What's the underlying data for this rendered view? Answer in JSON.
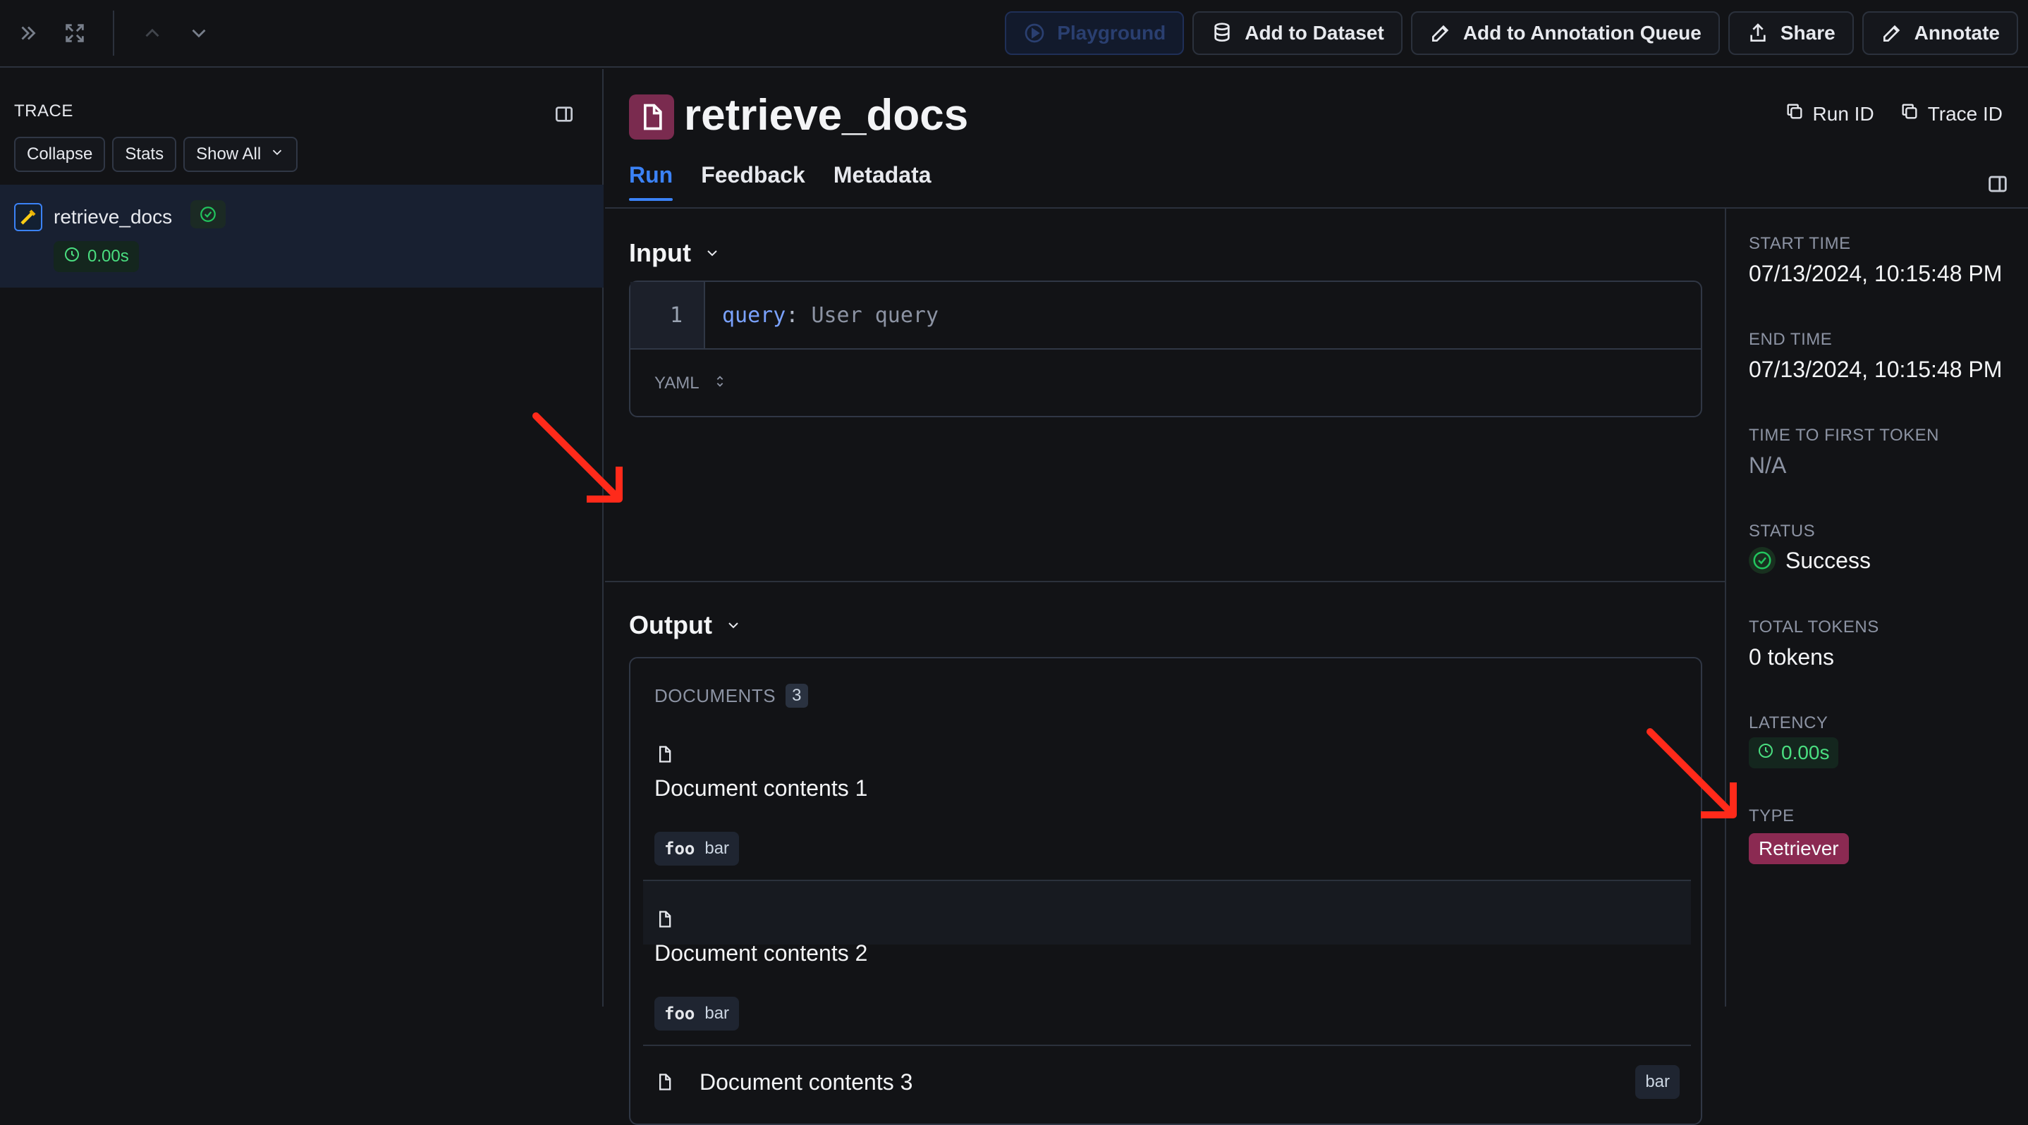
{
  "toolbar": {
    "buttons": [
      {
        "label": "Playground",
        "icon": "play-icon",
        "disabled": true
      },
      {
        "label": "Add to Dataset",
        "icon": "database-icon",
        "disabled": false
      },
      {
        "label": "Add to Annotation Queue",
        "icon": "pencil-icon",
        "disabled": false
      },
      {
        "label": "Share",
        "icon": "share-icon",
        "disabled": false
      },
      {
        "label": "Annotate",
        "icon": "pencil-icon",
        "disabled": false
      }
    ]
  },
  "trace": {
    "header": "TRACE",
    "actions": {
      "collapse": "Collapse",
      "stats": "Stats",
      "show_all": "Show All"
    },
    "run": {
      "name": "retrieve_docs",
      "latency": "0.00s"
    }
  },
  "run": {
    "title": "retrieve_docs",
    "ids": {
      "run_id": "Run ID",
      "trace_id": "Trace ID"
    },
    "tabs": [
      "Run",
      "Feedback",
      "Metadata"
    ],
    "active_tab": "Run",
    "input": {
      "title": "Input",
      "line_number": "1",
      "key": "query",
      "colon": ":",
      "value": "User query",
      "format": "YAML"
    },
    "output": {
      "title": "Output",
      "documents_label": "DOCUMENTS",
      "documents_count": "3",
      "documents": [
        {
          "content": "Document contents 1",
          "meta_key": "foo",
          "meta_value": "bar"
        },
        {
          "content": "Document contents 2",
          "meta_key": "foo",
          "meta_value": "bar"
        },
        {
          "content": "Document contents 3",
          "meta_value": "bar"
        }
      ]
    }
  },
  "details": {
    "start_time_label": "START TIME",
    "start_time": "07/13/2024, 10:15:48 PM",
    "end_time_label": "END TIME",
    "end_time": "07/13/2024, 10:15:48 PM",
    "ttft_label": "TIME TO FIRST TOKEN",
    "ttft": "N/A",
    "status_label": "STATUS",
    "status": "Success",
    "tokens_label": "TOTAL TOKENS",
    "tokens": "0 tokens",
    "latency_label": "LATENCY",
    "latency": "0.00s",
    "type_label": "TYPE",
    "type": "Retriever"
  },
  "colors": {
    "accent": "#3b82f6",
    "success": "#22c55e",
    "retriever": "#8b2a52",
    "annotation_arrow": "#ff2a1a"
  }
}
